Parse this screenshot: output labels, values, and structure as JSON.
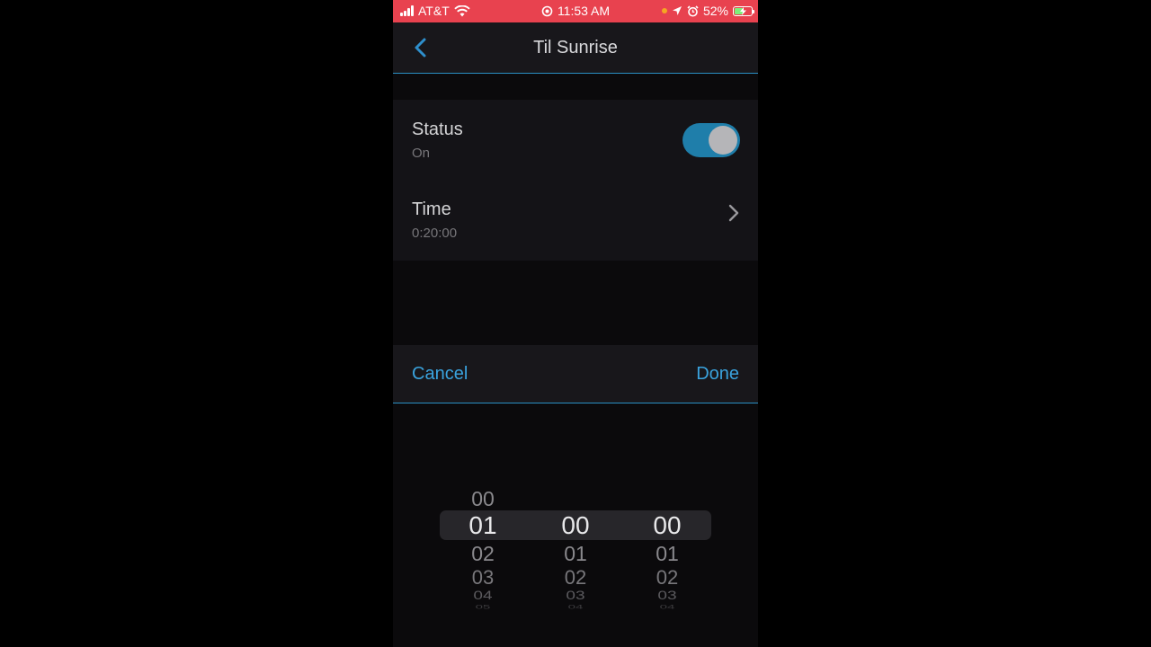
{
  "status_bar": {
    "carrier": "AT&T",
    "time": "11:53 AM",
    "battery": "52%",
    "battery_level": 0.52,
    "icons": [
      "signal-icon",
      "wifi-icon",
      "location-ring-icon",
      "orange-dot-icon",
      "location-arrow-icon",
      "alarm-icon",
      "battery-charging-icon"
    ]
  },
  "nav": {
    "title": "Til Sunrise",
    "back_icon": "chevron-left-icon"
  },
  "settings": {
    "status": {
      "label": "Status",
      "value": "On",
      "enabled": true
    },
    "time": {
      "label": "Time",
      "value": "0:20:00",
      "icon": "chevron-right-icon"
    }
  },
  "picker": {
    "cancel_label": "Cancel",
    "done_label": "Done",
    "hours": {
      "above": [
        "00"
      ],
      "selected": "01",
      "below": [
        "02",
        "03",
        "04",
        "05"
      ]
    },
    "minutes": {
      "above": [],
      "selected": "00",
      "below": [
        "01",
        "02",
        "03",
        "04"
      ]
    },
    "seconds": {
      "above": [],
      "selected": "00",
      "below": [
        "01",
        "02",
        "03",
        "04"
      ]
    }
  },
  "colors": {
    "status_bar": "#e8424f",
    "accent": "#3aa3de",
    "toggle_on": "#1f7eaa",
    "background": "#0b0a0c"
  }
}
